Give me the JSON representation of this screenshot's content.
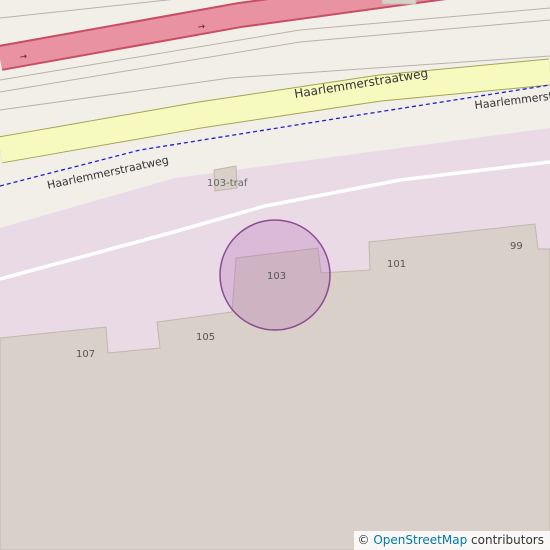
{
  "map": {
    "colors": {
      "background": "#f2efe9",
      "primary_road_fill": "#e892a2",
      "primary_road_casing": "#c84e64",
      "secondary_road_fill": "#f7fabf",
      "secondary_road_casing": "#a2a64c",
      "land_residential": "#e9dae6",
      "building": "#d9d0c9",
      "building_outline": "#c4b6ab",
      "boundary_line": "#2020d0",
      "marker_fill": "#b05cb2",
      "marker_stroke": "#7a2a82",
      "label_text": "#555555",
      "road_label_text": "#333333"
    },
    "roads": [
      {
        "name": "Haarlemmerstraatweg",
        "class": "secondary"
      },
      {
        "name": "Haarlemmerstraatweg",
        "class": "minor"
      }
    ],
    "road_labels": {
      "main": "Haarlemmerstraatweg",
      "side_left": "Haarlemmerstraatweg",
      "side_right": "Haarlemmerstraat"
    },
    "poi_label": "103-traf",
    "house_numbers": [
      "99",
      "101",
      "103",
      "105",
      "107"
    ],
    "marker": {
      "address_number": "103"
    },
    "one_way_arrow": "→"
  },
  "attribution": {
    "copyright_symbol": "©",
    "link_text": "OpenStreetMap",
    "suffix": " contributors"
  }
}
